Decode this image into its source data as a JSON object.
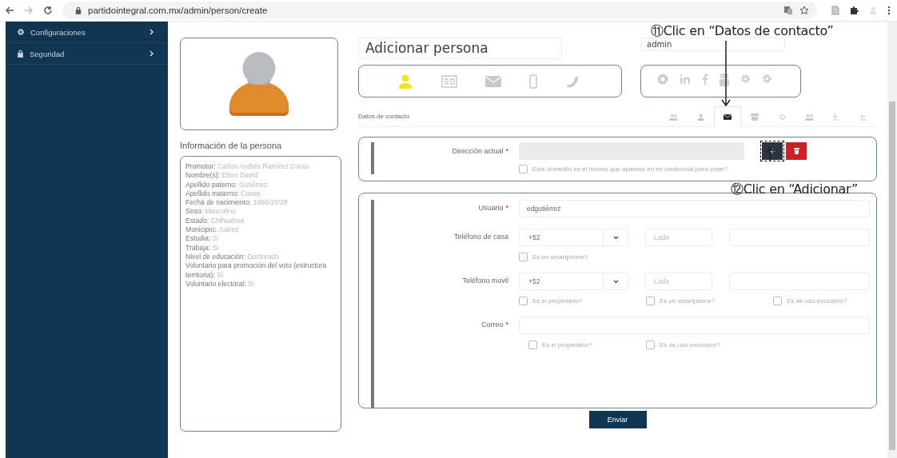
{
  "browser": {
    "url": "partidointegral.com.mx/admin/person/create"
  },
  "sidebar": {
    "items": [
      {
        "label": "Configuraciones"
      },
      {
        "label": "Seguridad"
      }
    ]
  },
  "person_info": {
    "title": "Información de la persona",
    "fields": [
      {
        "label": "Promotor:",
        "value": "Carlos Andrés Ramírez Corso"
      },
      {
        "label": "Nombre(s):",
        "value": "Efren David"
      },
      {
        "label": "Apellido paterno:",
        "value": "Gutiérrez"
      },
      {
        "label": "Apellido materno:",
        "value": "Casas"
      },
      {
        "label": "Fecha de nacimiento:",
        "value": "1966/10/29"
      },
      {
        "label": "Sexo:",
        "value": "Masculino"
      },
      {
        "label": "Estado:",
        "value": "Chihuahua"
      },
      {
        "label": "Municipio:",
        "value": "Juárez"
      },
      {
        "label": "Estudia:",
        "value": "Si"
      },
      {
        "label": "Trabaja:",
        "value": "Si"
      },
      {
        "label": "Nivel de educación:",
        "value": "Doctorado"
      },
      {
        "label": "Voluntario para promoción del voto (estructura territoria):",
        "value": "Si"
      },
      {
        "label": "Voluntario electoral:",
        "value": "Si"
      }
    ]
  },
  "form": {
    "title": "Adicionar persona",
    "user": "admin",
    "section_icons": [
      {
        "selected": true
      },
      {
        "selected": false
      },
      {
        "selected": false
      },
      {
        "selected": false
      },
      {
        "selected": false
      }
    ],
    "tabs": {
      "label": "Datos de contacto",
      "items": [
        {
          "selected": false
        },
        {
          "selected": false
        },
        {
          "selected": true
        },
        {
          "selected": false
        },
        {
          "selected": false
        },
        {
          "selected": false
        },
        {
          "selected": false
        },
        {
          "selected": false
        }
      ]
    },
    "address": {
      "label": "Dirección actual",
      "required_mark": "*",
      "checkbox": {
        "label": "Este domicilio es el mismo que aparece en mi credencial para votar?",
        "checked": false
      },
      "add_button": "+"
    },
    "contact_fields": [
      {
        "kind": "text",
        "label": "Usuario",
        "required_mark": "*",
        "value": "edgutiérrez"
      },
      {
        "kind": "phone",
        "label": "Teléfono de casa",
        "code": "+52",
        "lada_placeholder": "Lada",
        "checkboxes": [
          {
            "label": "Es un smartphone?",
            "checked": false
          }
        ]
      },
      {
        "kind": "phone",
        "label": "Teléfono movil",
        "code": "+52",
        "lada_placeholder": "Lada",
        "checkboxes": [
          {
            "label": "Es el propietario?",
            "checked": false
          },
          {
            "label": "Es un smartphone?",
            "checked": false
          },
          {
            "label": "Es de uso exclusivo?",
            "checked": false
          }
        ]
      },
      {
        "kind": "text",
        "label": "Correo",
        "required_mark": "*",
        "checkboxes": [
          {
            "label": "Es el propietario?",
            "checked": false
          },
          {
            "label": "Es de uso exclusivo?",
            "checked": false
          }
        ]
      }
    ],
    "submit": "Enviar"
  },
  "annotations": [
    {
      "number": "⑪",
      "text": "Clic en “Datos de contacto”"
    },
    {
      "number": "⑫",
      "text": "Clic en “Adicionar”"
    }
  ]
}
